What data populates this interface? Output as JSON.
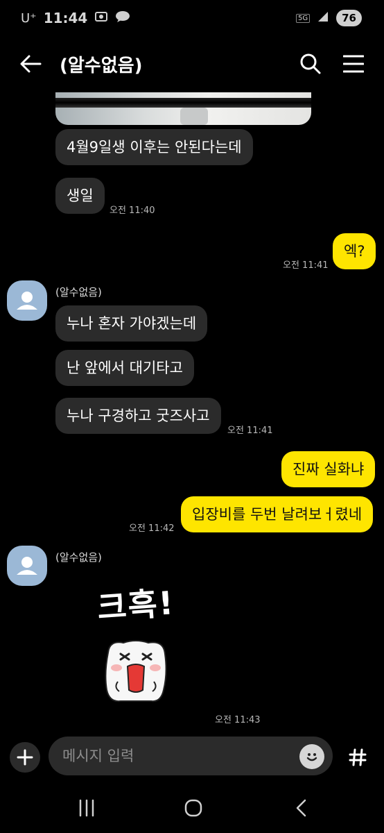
{
  "status_bar": {
    "carrier": "U⁺",
    "time": "11:44",
    "network": "5G",
    "battery": "76"
  },
  "header": {
    "title": "(알수없음)"
  },
  "messages": {
    "m1": "4월9일생 이후는 안된다는데",
    "m2": "생일",
    "t2": "오전 11:40",
    "m3": "엑?",
    "t3": "오전 11:41",
    "sender1": "(알수없음)",
    "m4": "누나 혼자 가야겠는데",
    "m5": "난 앞에서 대기타고",
    "m6": "누나 구경하고 굿즈사고",
    "t6": "오전 11:41",
    "m7": "진짜 실화냐",
    "m8": "입장비를 두번 날려보ㅓ렸네",
    "t8": "오전 11:42",
    "sender2": "(알수없음)",
    "sticker_text": "크흑!",
    "t9": "오전 11:43"
  },
  "input": {
    "placeholder": "메시지 입력"
  },
  "colors": {
    "incoming_bubble": "#2b2b2b",
    "outgoing_bubble": "#fee500",
    "avatar": "#9bb8d6"
  }
}
